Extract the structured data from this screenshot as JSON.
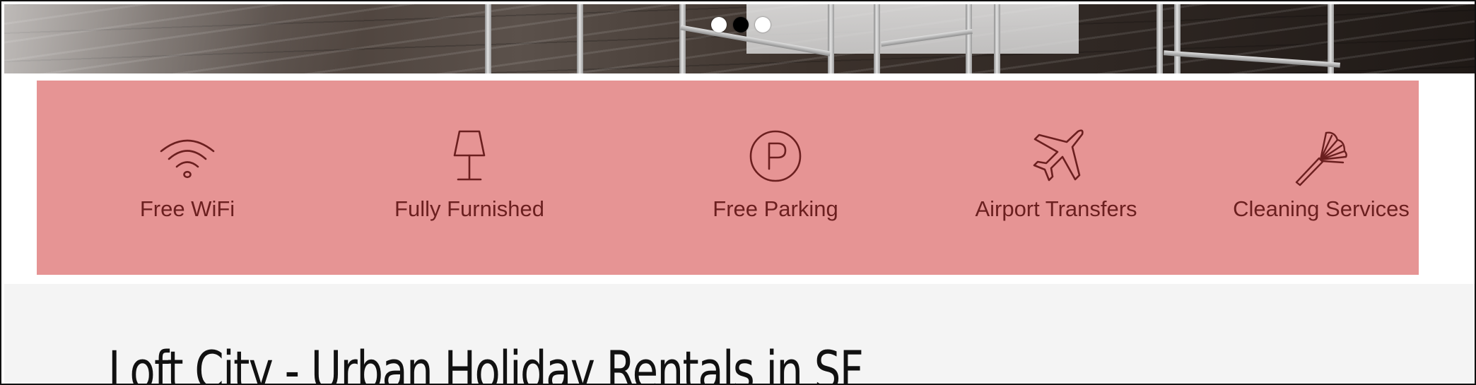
{
  "slideshow": {
    "dots": [
      {
        "label": "slide-1",
        "active": false
      },
      {
        "label": "slide-2",
        "active": true
      },
      {
        "label": "slide-3",
        "active": false
      }
    ]
  },
  "amenities": {
    "background_color": "#e69494",
    "text_color": "#6b1f1f",
    "items": [
      {
        "label": "Free WiFi",
        "icon": "wifi-icon"
      },
      {
        "label": "Fully Furnished",
        "icon": "lamp-icon"
      },
      {
        "label": "Free Parking",
        "icon": "parking-icon"
      },
      {
        "label": "Airport Transfers",
        "icon": "airplane-icon"
      },
      {
        "label": "Cleaning Services",
        "icon": "duster-icon"
      }
    ]
  },
  "main": {
    "title": "Loft City - Urban Holiday Rentals in SF"
  }
}
